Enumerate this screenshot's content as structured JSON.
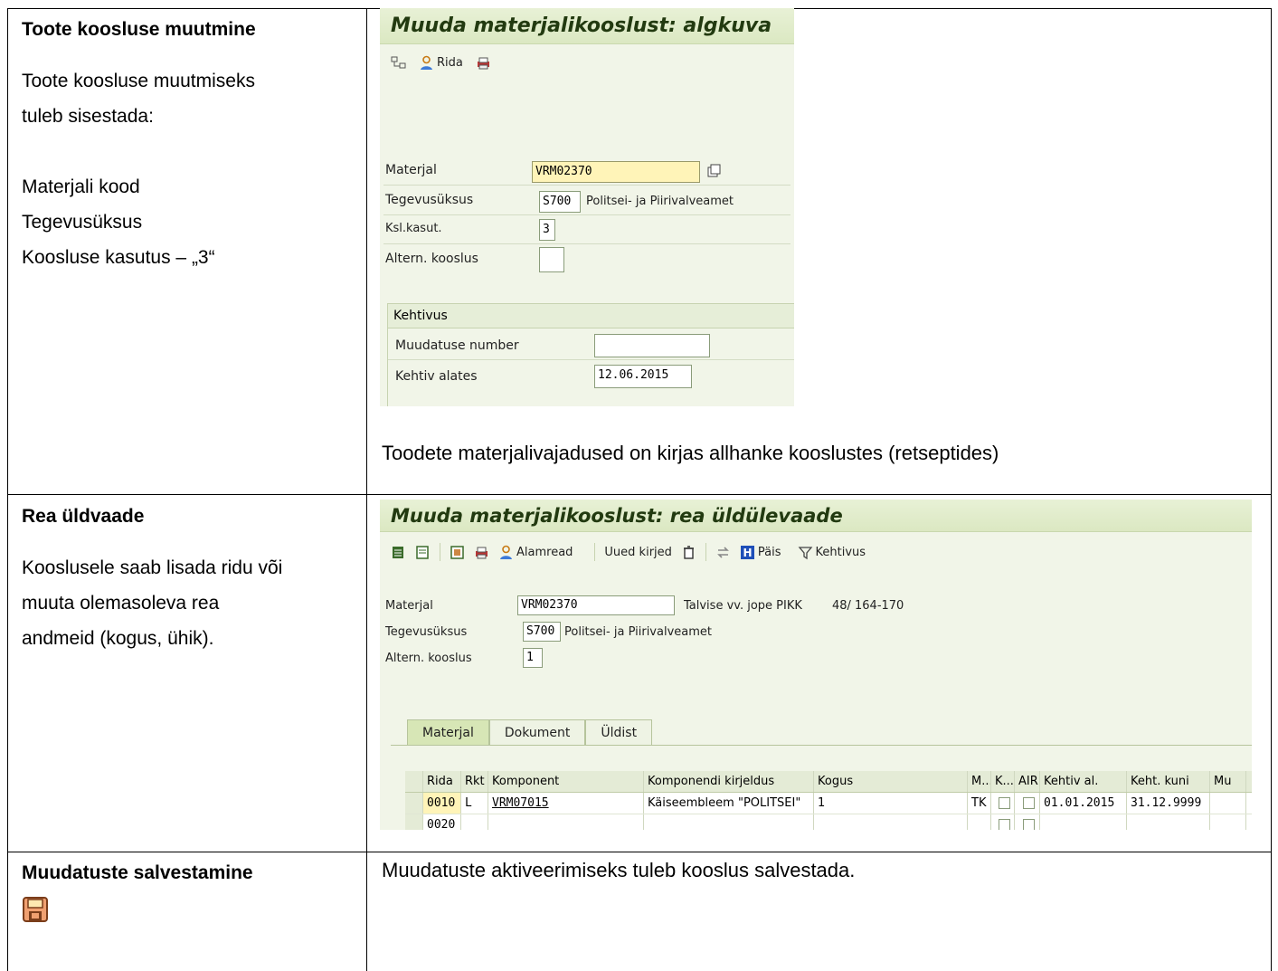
{
  "rows": [
    {
      "title": "Toote koosluse muutmine",
      "lines": [
        "Toote koosluse muutmiseks",
        "tuleb sisestada:",
        "",
        "Materjali kood",
        "Tegevusüksus",
        "Koosluse kasutus – „3“"
      ]
    },
    {
      "title": "Rea üldvaade",
      "lines": [
        "Kooslusele saab lisada ridu või",
        "muuta olemasoleva rea",
        "andmeid (kogus, ühik)."
      ]
    },
    {
      "title": "Muudatuste salvestamine",
      "icon": "save-disk-icon",
      "right_text": "Muudatuste aktiveerimiseks tuleb kooslus salvestada."
    }
  ],
  "screen1": {
    "title": "Muuda materjalikooslust: algkuva",
    "toolbar": {
      "rida_label": "Rida"
    },
    "fields": {
      "material_label": "Materjal",
      "material_value": "VRM02370",
      "unit_label": "Tegevusüksus",
      "unit_code": "S700",
      "unit_name": "Politsei- ja Piirivalveamet",
      "usage_label": "Ksl.kasut.",
      "usage_value": "3",
      "alt_label": "Altern. kooslus",
      "alt_value": ""
    },
    "validity": {
      "title": "Kehtivus",
      "change_label": "Muudatuse number",
      "change_value": "",
      "from_label": "Kehtiv alates",
      "from_value": "12.06.2015"
    },
    "caption": "Toodete materjalivajadused on kirjas allhanke kooslustes (retseptides)"
  },
  "screen2": {
    "title": "Muuda materjalikooslust: rea üldülevaade",
    "toolbar": {
      "alamread": "Alamread",
      "uued_kirjed": "Uued kirjed",
      "pais": "Päis",
      "kehtivus": "Kehtivus"
    },
    "fields": {
      "material_label": "Materjal",
      "material_value": "VRM02370",
      "material_desc": "Talvise vv. jope PIKK        48/ 164-170",
      "unit_label": "Tegevusüksus",
      "unit_code": "S700",
      "unit_name": "Politsei- ja Piirivalveamet",
      "alt_label": "Altern. kooslus",
      "alt_value": "1"
    },
    "tabs": [
      "Materjal",
      "Dokument",
      "Üldist"
    ],
    "columns": [
      "Rida",
      "Rkt",
      "Komponent",
      "Komponendi kirjeldus",
      "Kogus",
      "M...",
      "K...",
      "AIR",
      "Kehtiv al.",
      "Keht. kuni",
      "Mu"
    ],
    "grid_rows": [
      [
        "0010",
        "L",
        "VRM07015",
        "Käiseembleem \"POLITSEI\"",
        "1",
        "TK",
        "",
        "",
        "01.01.2015",
        "31.12.9999",
        ""
      ],
      [
        "0020",
        "",
        "",
        "",
        "",
        "",
        "",
        "",
        "",
        "",
        ""
      ]
    ]
  }
}
